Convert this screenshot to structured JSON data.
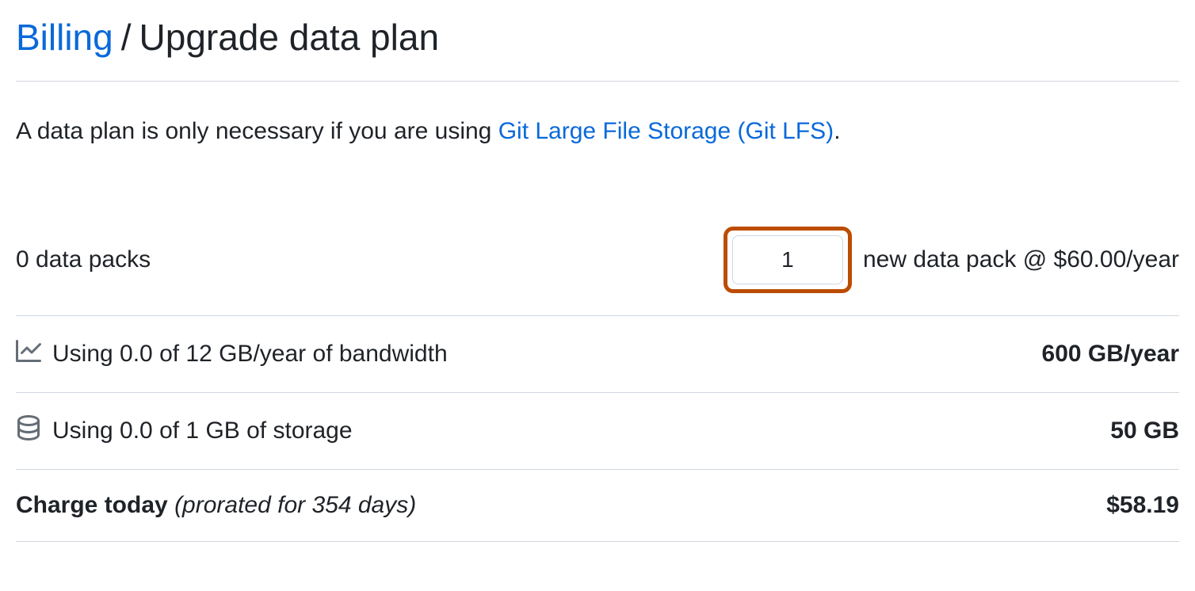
{
  "header": {
    "billing_link": "Billing",
    "separator": "/",
    "title": "Upgrade data plan"
  },
  "description": {
    "prefix": "A data plan is only necessary if you are using ",
    "link_text": "Git Large File Storage (Git LFS)",
    "suffix": "."
  },
  "packs": {
    "current_label": "0 data packs",
    "input_value": "1",
    "suffix_label": "new data pack @ $60.00/year"
  },
  "bandwidth": {
    "usage_label": "Using 0.0 of 12 GB/year of bandwidth",
    "value": "600 GB/year"
  },
  "storage": {
    "usage_label": "Using 0.0 of 1 GB of storage",
    "value": "50 GB"
  },
  "charge": {
    "label": "Charge today",
    "note": "(prorated for 354 days)",
    "value": "$58.19"
  }
}
